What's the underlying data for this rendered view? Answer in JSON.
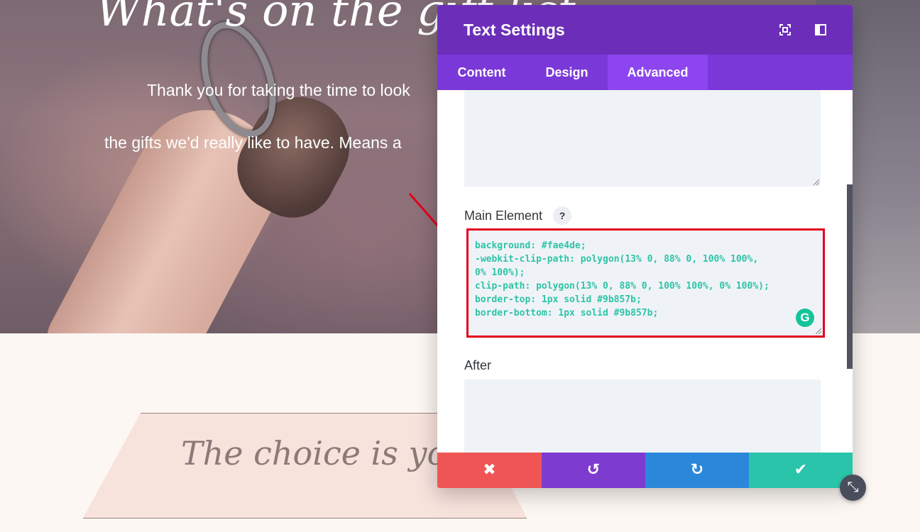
{
  "page": {
    "hero": {
      "title": "What's on the gift list",
      "line1": "Thank you for taking the time to look",
      "line2": "the gifts we'd really like to have. Means a"
    },
    "banner": {
      "text": "The choice is yours"
    }
  },
  "modal": {
    "title": "Text Settings",
    "header_icons": [
      "focus-icon",
      "sidebar-layout-icon"
    ],
    "tabs": [
      {
        "label": "Content",
        "active": false
      },
      {
        "label": "Design",
        "active": false
      },
      {
        "label": "Advanced",
        "active": true
      }
    ],
    "fields": {
      "main_element": {
        "label": "Main Element",
        "help": "?",
        "code": "background: #fae4de;\n-webkit-clip-path: polygon(13% 0, 88% 0, 100% 100%,\n0% 100%);\nclip-path: polygon(13% 0, 88% 0, 100% 100%, 0% 100%);\nborder-top: 1px solid #9b857b;\nborder-bottom: 1px solid #9b857b;"
      },
      "after": {
        "label": "After"
      }
    },
    "footer": {
      "cancel_icon": "✖",
      "undo_icon": "↺",
      "redo_icon": "↻",
      "save_icon": "✔"
    },
    "grammarly_glyph": "G",
    "expand_icon": "⤡"
  },
  "colors": {
    "header_purple": "#6c2eb9",
    "tabs_purple": "#7b38d8",
    "active_tab": "#8c45ef",
    "cancel_red": "#ef5555",
    "undo_purple": "#7e3bd0",
    "redo_blue": "#2b87da",
    "save_green": "#29c4a9",
    "highlight_red": "#e3001b",
    "code_green": "#2ec4a5"
  }
}
